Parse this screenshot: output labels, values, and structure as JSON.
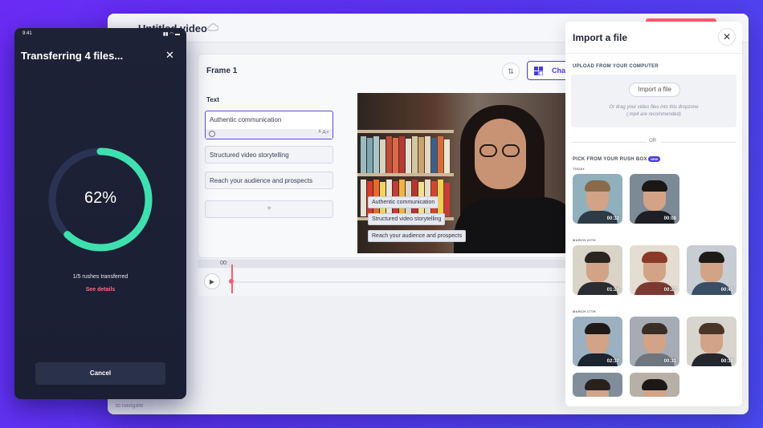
{
  "editor": {
    "title": "Untitled video",
    "frame_title": "Frame 1",
    "change_label": "Change",
    "text_section_label": "Text",
    "text_items": [
      "Authentic communication",
      "Structured video storytelling",
      "Reach your audience and prospects"
    ],
    "add_symbol": "+",
    "timeline_time": "00:",
    "nav_hint": "to navigate"
  },
  "phone": {
    "status_time": "9:41",
    "status_icons": "▮▮ ◠ ▬",
    "title": "Transferring 4 files...",
    "progress_percent": 62,
    "progress_label": "62%",
    "rushes_text": "1/5 rushes transferred",
    "see_details": "See details",
    "cancel_label": "Cancel",
    "progress_color": "#3fe0b0"
  },
  "panel": {
    "title": "Import a file",
    "upload_heading": "UPLOAD FROM YOUR COMPUTER",
    "import_button": "Import a file",
    "drop_hint_line1": "Or drag your video files into this dropzone",
    "drop_hint_line2": "(.mp4 are recommended)",
    "or_text": "OR",
    "rush_heading": "PICK FROM YOUR RUSH BOX",
    "new_badge": "NEW",
    "groups": [
      {
        "date": "TODAY",
        "durations": [
          "00:32",
          "00:08"
        ]
      },
      {
        "date": "MARCH 20TH",
        "durations": [
          "01:24",
          "00:27",
          "00:45"
        ]
      },
      {
        "date": "MARCH 17TH",
        "durations": [
          "02:37",
          "00:31",
          "00:38"
        ]
      }
    ]
  },
  "icons": {
    "close": "close-icon",
    "cloud": "cloud-icon",
    "play": "play-icon",
    "grid": "layout-grid-icon",
    "reorder": "reorder-icon"
  }
}
